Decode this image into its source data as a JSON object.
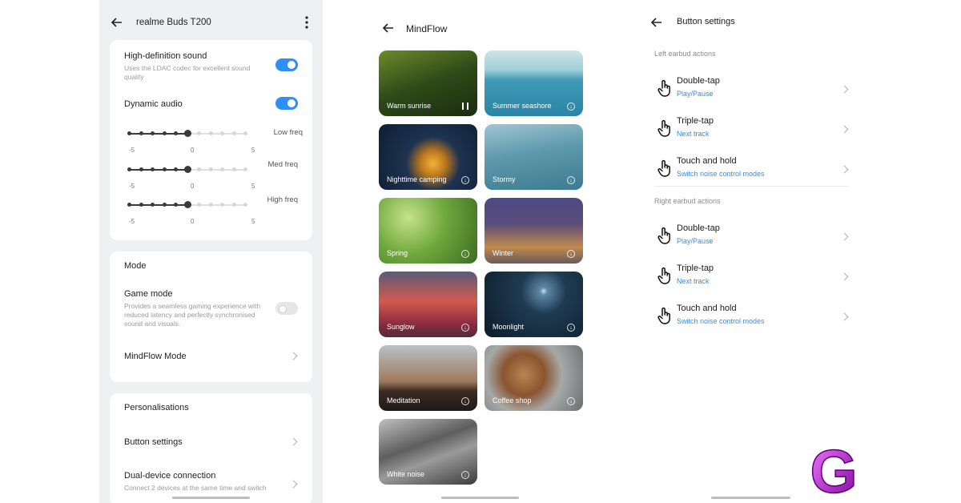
{
  "panel1": {
    "title": "realme Buds T200",
    "hd_sound": {
      "title": "High-definition sound",
      "desc": "Uses the LDAC codec for excellent sound quality",
      "on": true
    },
    "dynamic_audio": {
      "title": "Dynamic audio",
      "on": true
    },
    "eq": [
      {
        "label": "Low freq",
        "min": "-5",
        "mid": "0",
        "max": "5",
        "value": 0
      },
      {
        "label": "Med freq",
        "min": "-5",
        "mid": "0",
        "max": "5",
        "value": 0
      },
      {
        "label": "High freq",
        "min": "-5",
        "mid": "0",
        "max": "5",
        "value": 0
      }
    ],
    "mode": {
      "header": "Mode",
      "game_mode": {
        "title": "Game mode",
        "desc": "Provides a seamless gaming experience with reduced latency and perfectly synchronised sound and visuals.",
        "on": false
      },
      "mindflow": "MindFlow Mode"
    },
    "personal": {
      "header": "Personalisations",
      "button_settings": "Button settings",
      "dual": {
        "title": "Dual-device connection",
        "desc": "Connect 2 devices at the same time and switch"
      }
    }
  },
  "panel2": {
    "title": "MindFlow",
    "tiles": [
      {
        "label": "Warm sunrise",
        "state": "playing"
      },
      {
        "label": "Summer seashore",
        "state": "download"
      },
      {
        "label": "Nighttime camping",
        "state": "download"
      },
      {
        "label": "Stormy",
        "state": "download"
      },
      {
        "label": "Spring",
        "state": "download"
      },
      {
        "label": "Winter",
        "state": "download"
      },
      {
        "label": "Sunglow",
        "state": "download"
      },
      {
        "label": "Moonlight",
        "state": "download"
      },
      {
        "label": "Meditation",
        "state": "download"
      },
      {
        "label": "Coffee shop",
        "state": "download"
      },
      {
        "label": "White noise",
        "state": "download"
      }
    ]
  },
  "panel3": {
    "title": "Button settings",
    "left_header": "Left earbud actions",
    "right_header": "Right earbud actions",
    "left": [
      {
        "gesture": "Double-tap",
        "action": "Play/Pause"
      },
      {
        "gesture": "Triple-tap",
        "action": "Next track"
      },
      {
        "gesture": "Touch and hold",
        "action": "Switch noise control modes"
      }
    ],
    "right": [
      {
        "gesture": "Double-tap",
        "action": "Play/Pause"
      },
      {
        "gesture": "Triple-tap",
        "action": "Next track"
      },
      {
        "gesture": "Touch and hold",
        "action": "Switch noise control modes"
      }
    ]
  },
  "logo": {
    "letter": "G",
    "color": "#b100c8"
  },
  "colors": {
    "accent": "#2f8ff0",
    "panel_bg": "#eef0f2"
  }
}
